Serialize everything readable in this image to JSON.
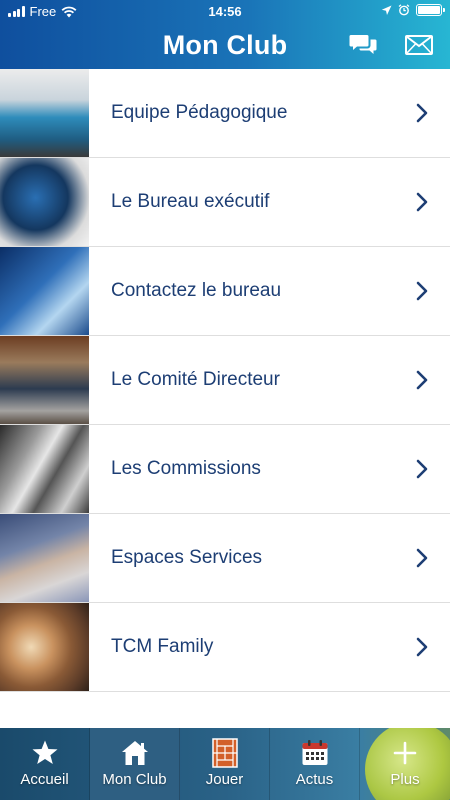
{
  "status": {
    "carrier": "Free",
    "time": "14:56"
  },
  "header": {
    "title": "Mon Club"
  },
  "list": {
    "items": [
      {
        "label": "Equipe Pédagogique"
      },
      {
        "label": "Le Bureau exécutif"
      },
      {
        "label": "Contactez le bureau"
      },
      {
        "label": "Le Comité Directeur"
      },
      {
        "label": "Les Commissions"
      },
      {
        "label": "Espaces Services"
      },
      {
        "label": "TCM Family"
      }
    ]
  },
  "tabbar": {
    "tabs": [
      {
        "label": "Accueil",
        "icon": "star-icon"
      },
      {
        "label": "Mon Club",
        "icon": "house-icon",
        "active": true
      },
      {
        "label": "Jouer",
        "icon": "tennis-court-icon"
      },
      {
        "label": "Actus",
        "icon": "calendar-icon"
      },
      {
        "label": "Plus",
        "icon": "plus-icon"
      }
    ]
  },
  "colors": {
    "header_start": "#0f4f9e",
    "header_end": "#27b6d3",
    "label_text": "#1d3e74",
    "divider": "#dedede"
  }
}
